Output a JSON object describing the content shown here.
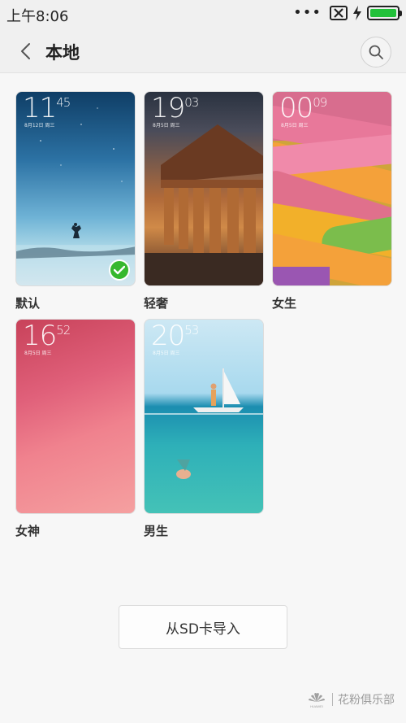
{
  "status_bar": {
    "time": "上午8:06",
    "battery_level_pct": 100,
    "icons": [
      "more-dots-icon",
      "sim-x-icon",
      "charging-bolt-icon",
      "battery-icon"
    ]
  },
  "header": {
    "title": "本地",
    "back_icon": "chevron-left-icon",
    "search_icon": "search-icon"
  },
  "themes": [
    {
      "label": "默认",
      "clock_hour": "11",
      "clock_min": "45",
      "date": "8月12日 周三",
      "selected": true
    },
    {
      "label": "轻奢",
      "clock_hour": "19",
      "clock_min": "03",
      "date": "8月5日 周三",
      "selected": false
    },
    {
      "label": "女生",
      "clock_hour": "00",
      "clock_min": "09",
      "date": "8月5日 周三",
      "selected": false
    },
    {
      "label": "女神",
      "clock_hour": "16",
      "clock_min": "52",
      "date": "8月5日 周三",
      "selected": false
    },
    {
      "label": "男生",
      "clock_hour": "20",
      "clock_min": "53",
      "date": "8月5日 周三",
      "selected": false
    }
  ],
  "import_button": {
    "label": "从SD卡导入"
  },
  "watermark": {
    "brand": "HUAWEI",
    "text": "花粉俱乐部"
  },
  "colors": {
    "accent_green": "#36b82e",
    "battery_green": "#22c13a"
  }
}
